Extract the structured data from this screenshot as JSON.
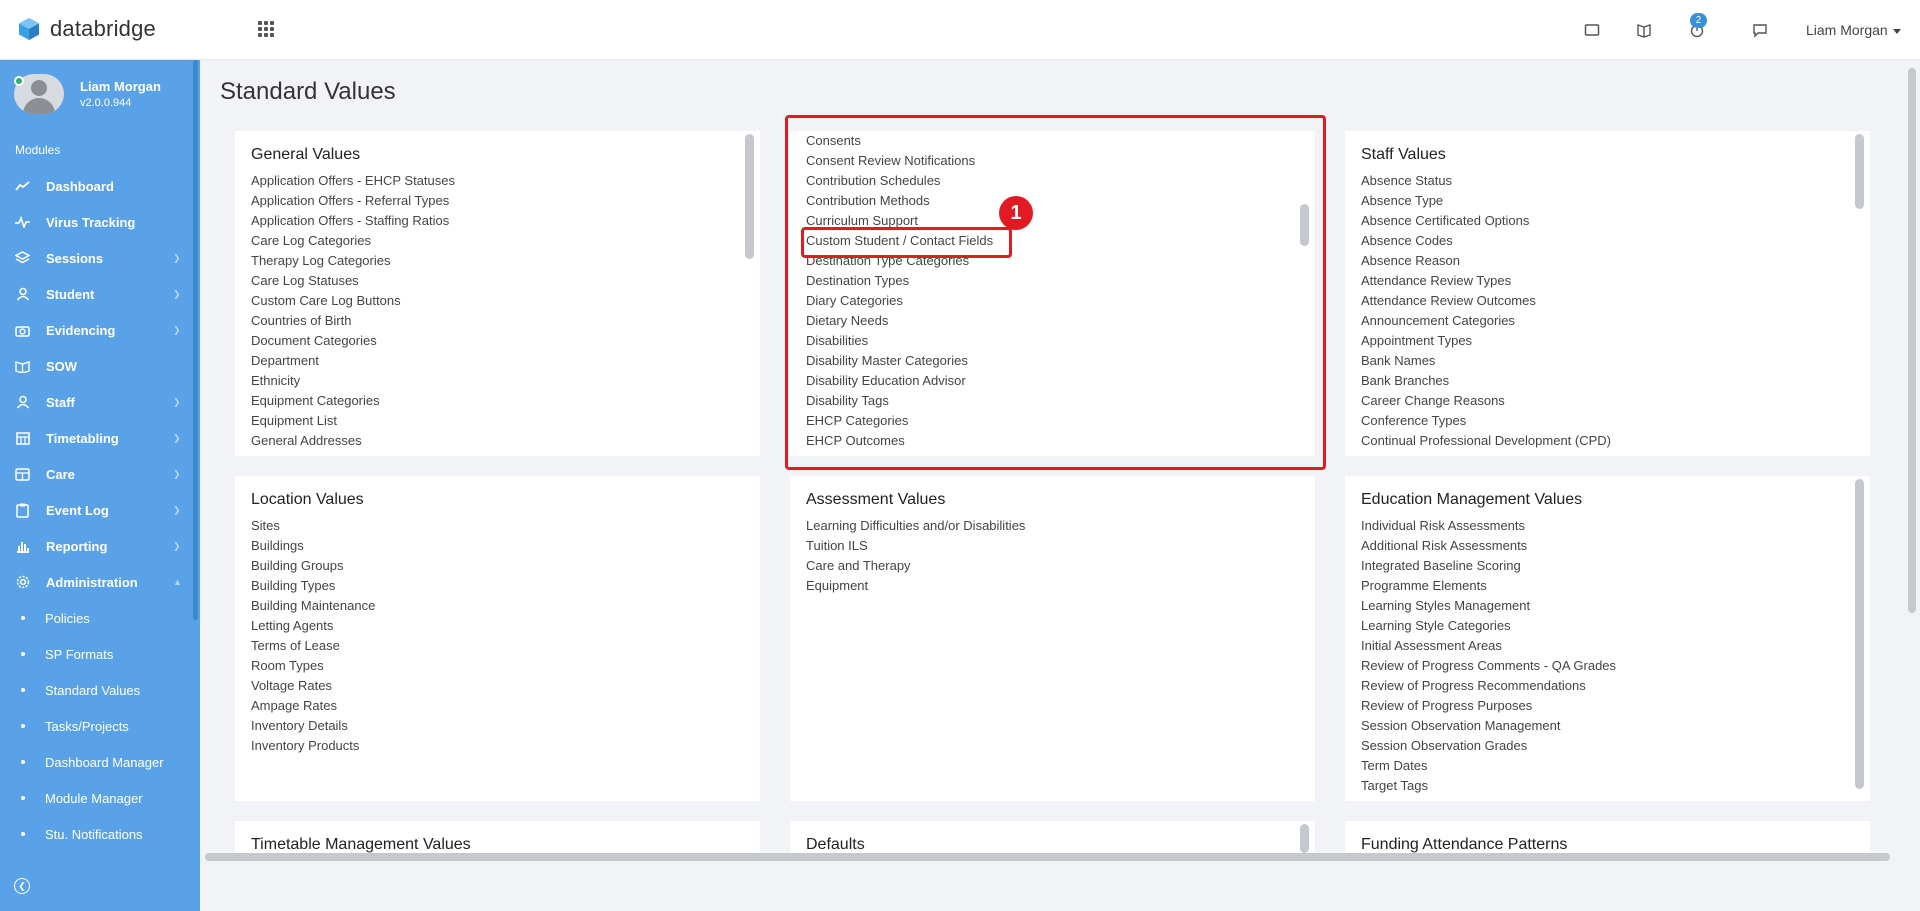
{
  "app": {
    "brand": "databridge",
    "user_menu": "Liam Morgan",
    "notification_count": "2"
  },
  "sidebar": {
    "profile_name": "Liam Morgan",
    "version": "v2.0.0.944",
    "modules_label": "Modules",
    "items": [
      {
        "label": "Dashboard",
        "icon": "chart-icon"
      },
      {
        "label": "Virus Tracking",
        "icon": "pulse-icon"
      },
      {
        "label": "Sessions",
        "icon": "layers-icon"
      },
      {
        "label": "Student",
        "icon": "student-icon"
      },
      {
        "label": "Evidencing",
        "icon": "camera-icon"
      },
      {
        "label": "SOW",
        "icon": "book-icon"
      },
      {
        "label": "Staff",
        "icon": "staff-icon"
      },
      {
        "label": "Timetabling",
        "icon": "calendar-icon"
      },
      {
        "label": "Care",
        "icon": "care-icon"
      },
      {
        "label": "Event Log",
        "icon": "clipboard-icon"
      },
      {
        "label": "Reporting",
        "icon": "bar-chart-icon"
      },
      {
        "label": "Administration",
        "icon": "gear-icon"
      }
    ],
    "sub_items": [
      "Policies",
      "SP Formats",
      "Standard Values",
      "Tasks/Projects",
      "Dashboard Manager",
      "Module Manager",
      "Stu. Notifications"
    ]
  },
  "page": {
    "title": "Standard Values"
  },
  "cards": {
    "general": {
      "title": "General Values",
      "items": [
        "Application Offers - EHCP Statuses",
        "Application Offers - Referral Types",
        "Application Offers - Staffing Ratios",
        "Care Log Categories",
        "Therapy Log Categories",
        "Care Log Statuses",
        "Custom Care Log Buttons",
        "Countries of Birth",
        "Document Categories",
        "Department",
        "Ethnicity",
        "Equipment Categories",
        "Equipment List",
        "General Addresses"
      ]
    },
    "student": {
      "items": [
        "Consents",
        "Consent Review Notifications",
        "Contribution Schedules",
        "Contribution Methods",
        "Curriculum Support",
        "Custom Student / Contact Fields",
        "Destination Type Categories",
        "Destination Types",
        "Diary Categories",
        "Dietary Needs",
        "Disabilities",
        "Disability Master Categories",
        "Disability Education Advisor",
        "Disability Tags",
        "EHCP Categories",
        "EHCP Outcomes"
      ]
    },
    "staff": {
      "title": "Staff Values",
      "items": [
        "Absence Status",
        "Absence Type",
        "Absence Certificated Options",
        "Absence Codes",
        "Absence Reason",
        "Attendance Review Types",
        "Attendance Review Outcomes",
        "Announcement Categories",
        "Appointment Types",
        "Bank Names",
        "Bank Branches",
        "Career Change Reasons",
        "Conference Types",
        "Continual Professional Development (CPD)"
      ]
    },
    "location": {
      "title": "Location Values",
      "items": [
        "Sites",
        "Buildings",
        "Building Groups",
        "Building Types",
        "Building Maintenance",
        "Letting Agents",
        "Terms of Lease",
        "Room Types",
        "Voltage Rates",
        "Ampage Rates",
        "Inventory Details",
        "Inventory Products"
      ]
    },
    "assessment": {
      "title": "Assessment Values",
      "items": [
        "Learning Difficulties and/or Disabilities",
        "Tuition ILS",
        "Care and Therapy",
        "Equipment"
      ]
    },
    "education": {
      "title": "Education Management Values",
      "items": [
        "Individual Risk Assessments",
        "Additional Risk Assessments",
        "Integrated Baseline Scoring",
        "Programme Elements",
        "Learning Styles Management",
        "Learning Style Categories",
        "Initial Assessment Areas",
        "Review of Progress Comments - QA Grades",
        "Review of Progress Recommendations",
        "Review of Progress Purposes",
        "Session Observation Management",
        "Session Observation Grades",
        "Term Dates",
        "Target Tags"
      ]
    },
    "timetable": {
      "title": "Timetable Management Values"
    },
    "defaults": {
      "title": "Defaults"
    },
    "funding": {
      "title": "Funding Attendance Patterns"
    }
  },
  "annotation": {
    "step_number": "1",
    "color": "#e01b24"
  },
  "colors": {
    "sidebar": "#5aa2e8",
    "accent": "#3a8fd9"
  }
}
